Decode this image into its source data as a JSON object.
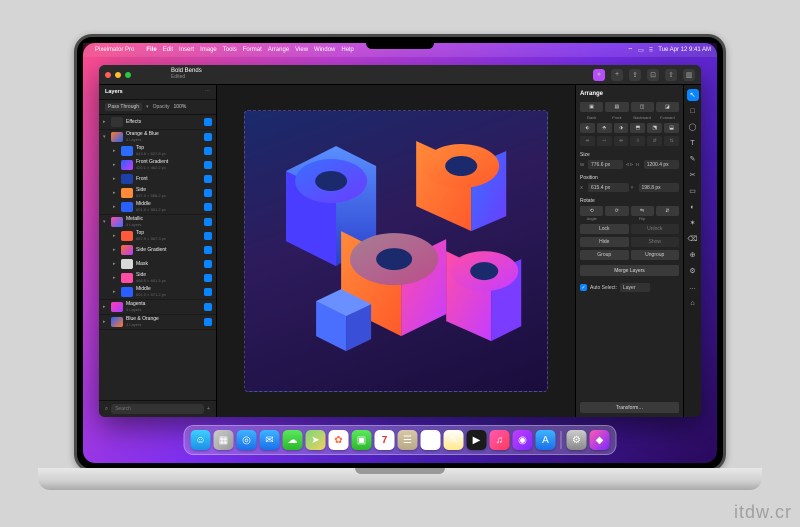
{
  "menubar": {
    "app": "Pixelmator Pro",
    "items": [
      "File",
      "Edit",
      "Insert",
      "Image",
      "Tools",
      "Format",
      "Arrange",
      "View",
      "Window",
      "Help"
    ],
    "clock": "Tue Apr 12  9:41 AM"
  },
  "document": {
    "title": "Bold Bends",
    "subtitle": "Edited"
  },
  "sidebar": {
    "title": "Layers",
    "blend_mode": "Pass Through",
    "opacity_label": "Opacity",
    "opacity_value": "100%",
    "search_placeholder": "Search",
    "groups": [
      {
        "name": "Effects",
        "sub": "",
        "thumb": "#333",
        "children": []
      },
      {
        "name": "Orange & Blue",
        "sub": "4 Layers",
        "thumb": "linear-gradient(135deg,#ff7a2a,#2a5fff)",
        "children": [
          {
            "name": "Top",
            "sub": "643.8 × 627.8 px",
            "thumb": "#2a6cff"
          },
          {
            "name": "Front Gradient",
            "sub": "420.1 × 462.2 px",
            "thumb": "linear-gradient(135deg,#2a5fff,#c43dff)"
          },
          {
            "name": "Front",
            "sub": "",
            "thumb": "#1e3fa8"
          },
          {
            "name": "Side",
            "sub": "637.0 × 588.2 px",
            "thumb": "#ff8a3a"
          },
          {
            "name": "Middle",
            "sub": "601.0 × 581.2 px",
            "thumb": "#2a5fff"
          }
        ]
      },
      {
        "name": "Metallic",
        "sub": "4 Layers",
        "thumb": "linear-gradient(135deg,#ff4da6,#3a6fff)",
        "children": [
          {
            "name": "Top",
            "sub": "657.9 × 567.3 px",
            "thumb": "#ff5a3a"
          },
          {
            "name": "Side Gradient",
            "sub": "",
            "thumb": "linear-gradient(135deg,#ff6a2a,#b43dff)"
          },
          {
            "name": "Mask",
            "sub": "",
            "thumb": "#d9d9d9"
          },
          {
            "name": "Side",
            "sub": "468.5 × 651.5 px",
            "thumb": "#ff4da6"
          },
          {
            "name": "Middle",
            "sub": "601.0 × 571.2 px",
            "thumb": "#2a5fff"
          }
        ]
      },
      {
        "name": "Magenta",
        "sub": "4 Layers",
        "thumb": "linear-gradient(135deg,#ff3db4,#a83dff)",
        "children": []
      },
      {
        "name": "Blue & Orange",
        "sub": "4 Layers",
        "thumb": "linear-gradient(135deg,#2a5fff,#ff7a2a)",
        "children": []
      }
    ]
  },
  "inspector": {
    "title": "Arrange",
    "order_labels": [
      "Back",
      "Front",
      "Backward",
      "Forward"
    ],
    "size_label": "Size",
    "size_w": "776.6 px",
    "size_h": "1200.4 px",
    "pos_label": "Position",
    "pos_x": "615.4 px",
    "pos_y": "198.8 px",
    "rotate_label": "Rotate",
    "angle_label": "Angle",
    "flip_label": "Flip",
    "lock": "Lock",
    "unlock": "Unlock",
    "hide": "Hide",
    "show": "Show",
    "group": "Group",
    "ungroup": "Ungroup",
    "merge": "Merge Layers",
    "auto_select_label": "Auto Select:",
    "auto_select_value": "Layer",
    "transform": "Transform…"
  },
  "tools": [
    "↖",
    "□",
    "◯",
    "T",
    "✎",
    "✂",
    "▭",
    "◐",
    "✶",
    "⌫",
    "⊕",
    "⚙",
    "…",
    "⌂"
  ],
  "dock": [
    {
      "name": "finder",
      "bg": "linear-gradient(180deg,#3dd0ff,#1a8fe8)",
      "glyph": "☺"
    },
    {
      "name": "launchpad",
      "bg": "linear-gradient(135deg,#ccc,#999)",
      "glyph": "▦"
    },
    {
      "name": "safari",
      "bg": "linear-gradient(180deg,#3db4ff,#1a6fe8)",
      "glyph": "◎"
    },
    {
      "name": "mail",
      "bg": "linear-gradient(180deg,#3db4ff,#1a6fe8)",
      "glyph": "✉"
    },
    {
      "name": "messages",
      "bg": "linear-gradient(180deg,#5ce85c,#2bb82b)",
      "glyph": "☁"
    },
    {
      "name": "maps",
      "bg": "linear-gradient(135deg,#7ad87a,#f0d060)",
      "glyph": "➤"
    },
    {
      "name": "photos",
      "bg": "#fff",
      "glyph": "✿"
    },
    {
      "name": "facetime",
      "bg": "linear-gradient(180deg,#5ce85c,#2bb82b)",
      "glyph": "▣"
    },
    {
      "name": "calendar",
      "bg": "#fff",
      "glyph": "7"
    },
    {
      "name": "contacts",
      "bg": "linear-gradient(180deg,#d8c8a8,#b8a888)",
      "glyph": "☰"
    },
    {
      "name": "reminders",
      "bg": "#fff",
      "glyph": "≡"
    },
    {
      "name": "notes",
      "bg": "linear-gradient(180deg,#fff,#ffe88a)",
      "glyph": "✎"
    },
    {
      "name": "tv",
      "bg": "#1a1a1a",
      "glyph": "▶"
    },
    {
      "name": "music",
      "bg": "linear-gradient(135deg,#ff5ab4,#ff3a5a)",
      "glyph": "♫"
    },
    {
      "name": "podcasts",
      "bg": "linear-gradient(135deg,#c43dff,#7a2aff)",
      "glyph": "◉"
    },
    {
      "name": "appstore",
      "bg": "linear-gradient(180deg,#3db4ff,#1a6fe8)",
      "glyph": "A"
    },
    {
      "name": "settings",
      "bg": "linear-gradient(180deg,#ccc,#888)",
      "glyph": "⚙"
    },
    {
      "name": "pixelmator",
      "bg": "linear-gradient(135deg,#ff5ab4,#7a2aff)",
      "glyph": "◆"
    }
  ],
  "watermark": "itdw.cr"
}
